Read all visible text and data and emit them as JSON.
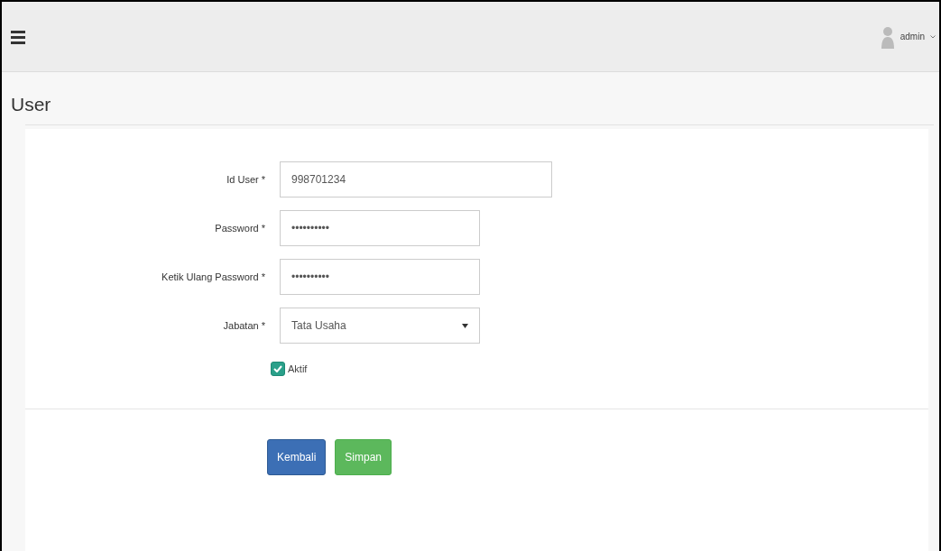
{
  "topbar": {
    "user": "admin"
  },
  "page": {
    "title": "User"
  },
  "form": {
    "fields": [
      {
        "kind": "text",
        "label": "Id User *",
        "value": "998701234",
        "wide": true
      },
      {
        "kind": "text",
        "label": "Password *",
        "value": "••••••••••",
        "wide": false
      },
      {
        "kind": "text",
        "label": "Ketik Ulang Password *",
        "value": "••••••••••",
        "wide": false
      },
      {
        "kind": "select",
        "label": "Jabatan *",
        "value": "Tata Usaha",
        "wide": false
      }
    ],
    "checkbox": {
      "label": "Aktif",
      "checked": true
    },
    "buttons": [
      {
        "kind": "primary",
        "label": "Kembali"
      },
      {
        "kind": "success",
        "label": "Simpan"
      }
    ]
  }
}
